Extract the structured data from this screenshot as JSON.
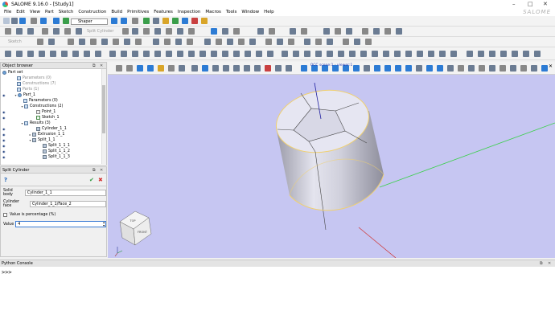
{
  "window": {
    "title": "SALOME 9.16.0 - [Study1]",
    "minimize": "–",
    "maximize": "□",
    "close": "✕"
  },
  "menu": [
    "File",
    "Edit",
    "View",
    "Part",
    "Sketch",
    "Construction",
    "Build",
    "Primitives",
    "Features",
    "Inspection",
    "Macros",
    "Tools",
    "Window",
    "Help"
  ],
  "brand": "SALOME",
  "toolbar": {
    "module_combo": "Shaper",
    "disabled_a": "Split Cylinder",
    "disabled_b": "Sketch"
  },
  "object_browser": {
    "title": "Object browser",
    "items": [
      {
        "label": "Part set",
        "icon": "part-icon"
      },
      {
        "label": "Parameters (0)",
        "icon": "folder-icon"
      },
      {
        "label": "Constructions (7)",
        "icon": "folder-icon"
      },
      {
        "label": "Parts (1)",
        "icon": "folder-icon"
      },
      {
        "label": "Part_1",
        "icon": "part-icon"
      },
      {
        "label": "Parameters (0)",
        "icon": "folder-icon"
      },
      {
        "label": "Constructions (2)",
        "icon": "folder-icon"
      },
      {
        "label": "Point_1",
        "icon": "point-icon"
      },
      {
        "label": "Sketch_1",
        "icon": "sketch-icon"
      },
      {
        "label": "Results (3)",
        "icon": "folder-icon"
      },
      {
        "label": "Cylinder_1_1",
        "icon": "solid-icon"
      },
      {
        "label": "Extrusion_1_1",
        "icon": "solid-icon"
      },
      {
        "label": "Split_1_1",
        "icon": "solid-icon"
      },
      {
        "label": "Split_1_1_1",
        "icon": "solid-icon"
      },
      {
        "label": "Split_1_1_2",
        "icon": "solid-icon"
      },
      {
        "label": "Split_1_1_3",
        "icon": "solid-icon"
      }
    ]
  },
  "property_panel": {
    "title": "Split Cylinder",
    "help": "?",
    "ok": "✔",
    "cancel": "✖",
    "solid_body_label": "Solid body",
    "solid_body_value": "Cylinder_1_1",
    "cylinder_face_label": "Cylinder face",
    "cylinder_face_value": "Cylinder_1_1/Face_2",
    "percentage_label": "Value is percentage (%)",
    "percentage_checked": false,
    "value_label": "Value",
    "value_value": "4"
  },
  "viewer": {
    "label": "OCC scene:1 - viewer:1",
    "cube_faces": [
      "TOP",
      "FRONT",
      "LEFT"
    ],
    "background": "#c6c6f2"
  },
  "python_console": {
    "title": "Python Console",
    "prompt": ">>>"
  }
}
